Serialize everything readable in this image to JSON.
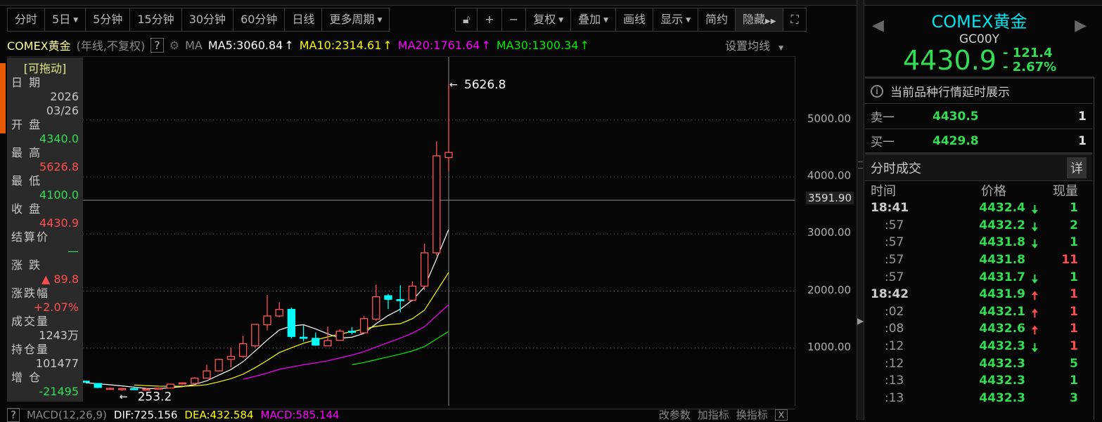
{
  "toolbar": {
    "periods": [
      "分时",
      "5日",
      "5分钟",
      "15分钟",
      "30分钟",
      "60分钟",
      "日线",
      "更多周期"
    ],
    "tools": [
      "复权",
      "叠加",
      "画线",
      "显示",
      "简约",
      "隐藏"
    ]
  },
  "legend": {
    "title": "COMEX黄金",
    "mode": "(年线,不复权)",
    "help": "?",
    "ma_label": "MA",
    "ma5": "MA5:3060.84",
    "ma10": "MA10:2314.61",
    "ma20": "MA20:1761.64",
    "ma30": "MA30:1300.34",
    "settings": "设置均线"
  },
  "info_panel": {
    "drag": "[可拖动]",
    "items": [
      {
        "label": "日 期",
        "value": "2026"
      },
      {
        "label": "",
        "value": "03/26"
      },
      {
        "label": "开 盘",
        "value": "4340.0"
      },
      {
        "label": "最 高",
        "value": "5626.8"
      },
      {
        "label": "最 低",
        "value": "4100.0"
      },
      {
        "label": "收 盘",
        "value": "4430.9"
      },
      {
        "label": "结算价",
        "value": "—"
      },
      {
        "label": "涨 跌",
        "value": "▲ 89.8"
      },
      {
        "label": "涨跌幅",
        "value": "+2.07%"
      },
      {
        "label": "成交量",
        "value": "1243万"
      },
      {
        "label": "持仓量",
        "value": "101477"
      },
      {
        "label": "增 仓",
        "value": "-21495"
      }
    ]
  },
  "chart_data": {
    "type": "candlestick",
    "title": "COMEX黄金 (年线,不复权)",
    "ylim": [
      0,
      6100
    ],
    "yticks": [
      "1000.00",
      "2000.00",
      "3000.00",
      "4000.00",
      "5000.00"
    ],
    "crosshair_value": "3591.90",
    "max_label": "5626.8",
    "min_label": "253.2",
    "candles": [
      [
        420,
        430,
        400,
        400
      ],
      [
        380,
        385,
        300,
        310
      ],
      [
        295,
        310,
        285,
        295
      ],
      [
        290,
        300,
        253.2,
        290
      ],
      [
        290,
        310,
        275,
        285
      ],
      [
        275,
        300,
        260,
        280
      ],
      [
        280,
        300,
        270,
        300
      ],
      [
        300,
        375,
        295,
        368
      ],
      [
        385,
        400,
        360,
        390
      ],
      [
        381,
        490,
        375,
        474
      ],
      [
        474,
        707,
        470,
        600
      ],
      [
        600,
        815,
        590,
        802
      ],
      [
        802,
        1010,
        665,
        854
      ],
      [
        854,
        1212,
        830,
        1077
      ],
      [
        1040,
        1420,
        1010,
        1416
      ],
      [
        1410,
        1933,
        1310,
        1563
      ],
      [
        1563,
        1803,
        1540,
        1678
      ],
      [
        1678,
        1711,
        1170,
        1204
      ],
      [
        1190,
        1395,
        1115,
        1183
      ],
      [
        1171,
        1272,
        1040,
        1052
      ],
      [
        1040,
        1381,
        1035,
        1133
      ],
      [
        1136,
        1330,
        1130,
        1297
      ],
      [
        1295,
        1370,
        1240,
        1289
      ],
      [
        1268,
        1563,
        1255,
        1517
      ],
      [
        1508,
        2112,
        1480,
        1900
      ],
      [
        1918,
        1951,
        1686,
        1855
      ],
      [
        1850,
        2100,
        1626,
        1847
      ],
      [
        1838,
        2172,
        1820,
        2087
      ],
      [
        2087,
        2830,
        2020,
        2670
      ],
      [
        2670,
        4625,
        2620,
        4370
      ],
      [
        4340,
        5626.8,
        4100,
        4430.9
      ]
    ],
    "ma": [
      {
        "name": "MA5",
        "period": 5,
        "color": "#ffffff"
      },
      {
        "name": "MA10",
        "period": 10,
        "color": "#ffff00",
        "start": 4
      },
      {
        "name": "MA20",
        "period": 20,
        "color": "#ff00ff",
        "start": 13
      },
      {
        "name": "MA30",
        "period": 30,
        "color": "#00ee00",
        "start": 22
      }
    ],
    "up_color": "#ff5555",
    "down_color": "#00ffff"
  },
  "macd": {
    "help": "?",
    "name": "MACD(12,26,9)",
    "dif": "DIF:725.156",
    "dea": "DEA:432.584",
    "macd": "MACD:585.144",
    "actions": [
      "改参数",
      "加指标",
      "换指标"
    ],
    "close": "X"
  },
  "quote": {
    "name": "COMEX黄金",
    "code": "GC00Y",
    "price": "4430.9",
    "change": "- 121.4",
    "pct": "- 2.67%",
    "notice": "当前品种行情延时展示",
    "sell_label": "卖一",
    "sell_price": "4430.5",
    "sell_vol": "1",
    "buy_label": "买一",
    "buy_price": "4429.8",
    "buy_vol": "1",
    "trades_title": "分时成交",
    "detail": "详",
    "cols": [
      "时间",
      "价格",
      "现量"
    ],
    "trades": [
      {
        "t": "18:41",
        "p": "4432.4",
        "a": "down",
        "v": "1",
        "vc": "g",
        "bold": true
      },
      {
        "t": ":57",
        "p": "4432.2",
        "a": "down",
        "v": "2",
        "vc": "g"
      },
      {
        "t": ":57",
        "p": "4431.8",
        "a": "down",
        "v": "1",
        "vc": "g"
      },
      {
        "t": ":57",
        "p": "4431.8",
        "a": "",
        "v": "11",
        "vc": "r"
      },
      {
        "t": ":57",
        "p": "4431.7",
        "a": "down",
        "v": "1",
        "vc": "g"
      },
      {
        "t": "18:42",
        "p": "4431.9",
        "a": "up",
        "v": "1",
        "vc": "r",
        "bold": true
      },
      {
        "t": ":02",
        "p": "4432.1",
        "a": "up",
        "v": "1",
        "vc": "r"
      },
      {
        "t": ":08",
        "p": "4432.6",
        "a": "up",
        "v": "1",
        "vc": "r"
      },
      {
        "t": ":12",
        "p": "4432.3",
        "a": "down",
        "v": "1",
        "vc": "r"
      },
      {
        "t": ":12",
        "p": "4432.3",
        "a": "",
        "v": "5",
        "vc": "g"
      },
      {
        "t": ":13",
        "p": "4432.3",
        "a": "",
        "v": "1",
        "vc": "g"
      },
      {
        "t": ":13",
        "p": "4432.3",
        "a": "",
        "v": "3",
        "vc": "g"
      }
    ]
  }
}
